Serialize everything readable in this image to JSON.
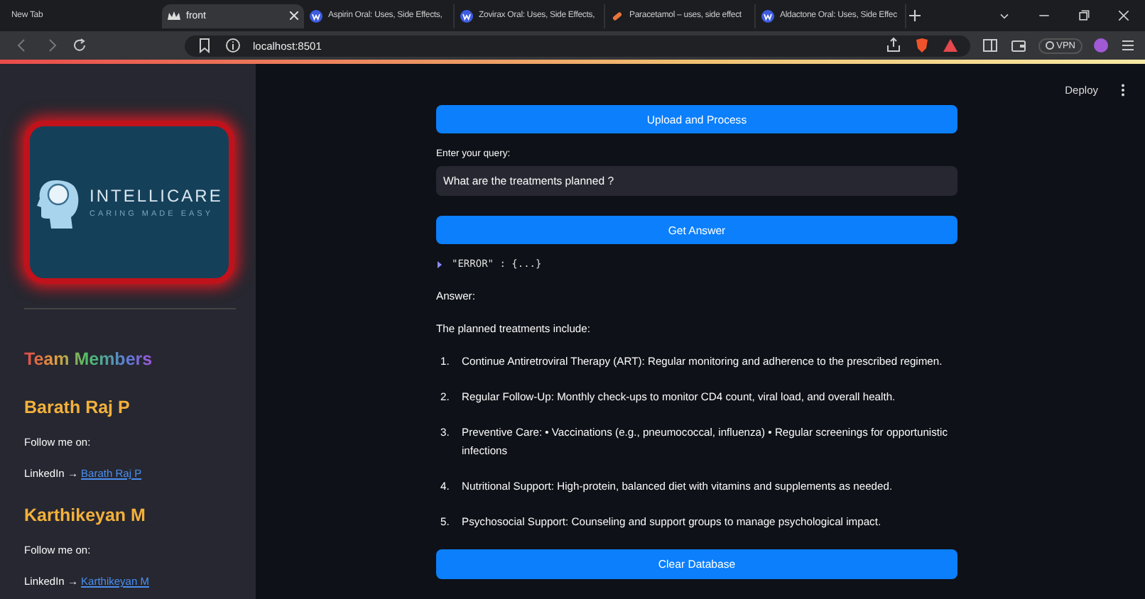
{
  "browser": {
    "tabs": [
      {
        "title": "New Tab",
        "kind": "plain",
        "selected": false
      },
      {
        "title": "front",
        "kind": "crown",
        "selected": true
      },
      {
        "title": "Aspirin Oral: Uses, Side Effects,",
        "kind": "circle",
        "selected": false
      },
      {
        "title": "Zovirax Oral: Uses, Side Effects,",
        "kind": "circle",
        "selected": false
      },
      {
        "title": "Paracetamol – uses, side effect",
        "kind": "pill",
        "selected": false
      },
      {
        "title": "Aldactone Oral: Uses, Side Effec",
        "kind": "circle",
        "selected": false
      }
    ],
    "address": "localhost:8501",
    "vpn": "VPN"
  },
  "sidebar": {
    "logo": {
      "title": "INTELLICARE",
      "tagline": "CARING MADE EASY"
    },
    "heading": "Team Members",
    "members": [
      {
        "name": "Barath Raj P",
        "follow": "Follow me on:",
        "network": "LinkedIn →",
        "link": "Barath Raj P"
      },
      {
        "name": "Karthikeyan M",
        "follow": "Follow me on:",
        "network": "LinkedIn →",
        "link": "Karthikeyan M"
      }
    ]
  },
  "header": {
    "deploy": "Deploy"
  },
  "main": {
    "upload_button": "Upload and Process",
    "query_label": "Enter your query:",
    "query_value": "What are the treatments planned ?",
    "answer_button": "Get Answer",
    "json_viewer": {
      "expanded": false,
      "text": "\"ERROR\" : {...}"
    },
    "answer_label": "Answer:",
    "intro": "The planned treatments include:",
    "items": [
      {
        "number": "1.",
        "text": "Continue Antiretroviral Therapy (ART): Regular monitoring and adherence to the prescribed regimen."
      },
      {
        "number": "2.",
        "text": "Regular Follow-Up: Monthly check-ups to monitor CD4 count, viral load, and overall health."
      },
      {
        "number": "3.",
        "text": "Preventive Care: • Vaccinations (e.g., pneumococcal, influenza) • Regular screenings for opportunistic infections"
      },
      {
        "number": "4.",
        "text": "Nutritional Support: High-protein, balanced diet with vitamins and supplements as needed."
      },
      {
        "number": "5.",
        "text": "Psychosocial Support: Counseling and support groups to manage psychological impact."
      }
    ],
    "clear_button": "Clear Database"
  }
}
